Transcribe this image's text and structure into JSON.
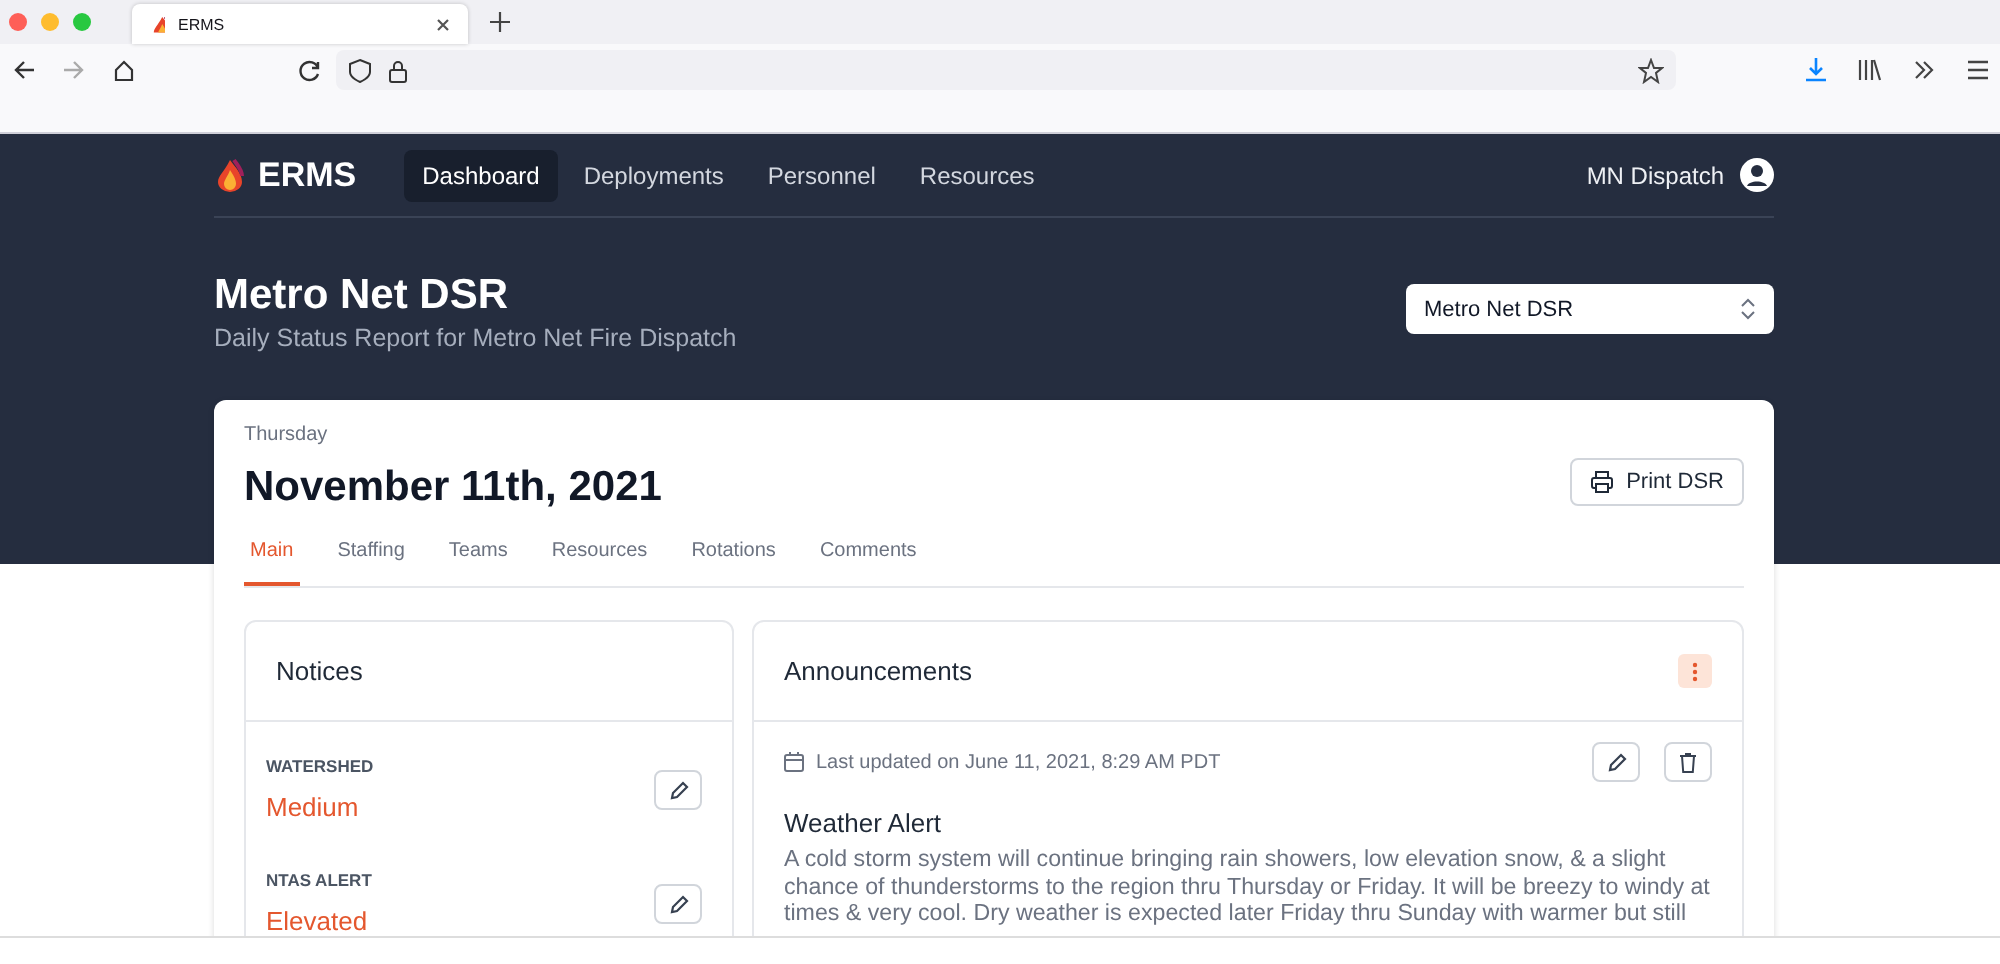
{
  "browser": {
    "tab": {
      "title": "ERMS"
    }
  },
  "header": {
    "brand": "ERMS",
    "nav": [
      {
        "label": "Dashboard",
        "selected": true
      },
      {
        "label": "Deployments",
        "selected": false
      },
      {
        "label": "Personnel",
        "selected": false
      },
      {
        "label": "Resources",
        "selected": false
      }
    ],
    "user": "MN Dispatch"
  },
  "page": {
    "title": "Metro Net DSR",
    "subtitle": "Daily Status Report for Metro Net Fire Dispatch",
    "report_select": {
      "value": "Metro Net DSR"
    }
  },
  "report": {
    "day": "Thursday",
    "date": "November 11th, 2021",
    "print_button": "Print DSR",
    "tabs": [
      {
        "label": "Main",
        "selected": true
      },
      {
        "label": "Staffing",
        "selected": false
      },
      {
        "label": "Teams",
        "selected": false
      },
      {
        "label": "Resources",
        "selected": false
      },
      {
        "label": "Rotations",
        "selected": false
      },
      {
        "label": "Comments",
        "selected": false
      }
    ]
  },
  "notices": {
    "title": "Notices",
    "items": [
      {
        "label": "WATERSHED",
        "value": "Medium"
      },
      {
        "label": "NTAS ALERT",
        "value": "Elevated"
      }
    ]
  },
  "announcements": {
    "title": "Announcements",
    "updated": "Last updated on June 11, 2021, 8:29 AM PDT",
    "items": [
      {
        "title": "Weather Alert",
        "body": "A cold storm system will continue bringing rain showers, low elevation snow, & a slight chance of thunderstorms to the region thru Thursday or Friday. It will be breezy to windy at times & very cool. Dry weather is expected later Friday thru Sunday with warmer but still"
      }
    ]
  }
}
